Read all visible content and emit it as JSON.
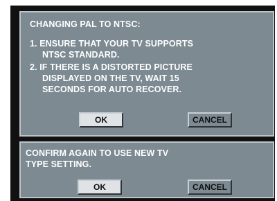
{
  "dialog_pal": {
    "title": "CHANGING PAL TO NTSC:",
    "lines": [
      "1. ENSURE THAT YOUR TV SUPPORTS",
      "NTSC STANDARD.",
      "2. IF THERE IS A DISTORTED PICTURE",
      "DISPLAYED ON THE TV, WAIT 15",
      "SECONDS FOR AUTO RECOVER."
    ],
    "ok_label": "OK",
    "cancel_label": "CANCEL"
  },
  "dialog_confirm": {
    "lines": [
      "CONFIRM AGAIN TO USE NEW TV",
      "TYPE SETTING."
    ],
    "ok_label": "OK",
    "cancel_label": "CANCEL"
  },
  "colors": {
    "dialog_background": "#7d8a92",
    "dialog_border": "#bcc4c8",
    "screen_background": "#111111",
    "text": "#ffffff"
  }
}
